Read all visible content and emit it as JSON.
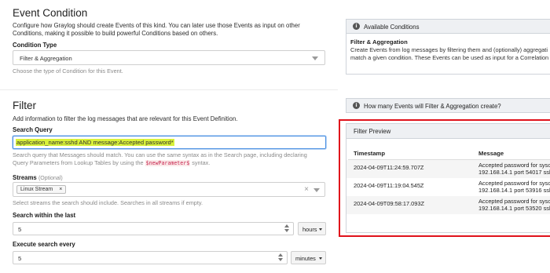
{
  "event_condition": {
    "title": "Event Condition",
    "description": "Configure how Graylog should create Events of this kind. You can later use those Events as input on other Conditions, making it possible to build powerful Conditions based on others.",
    "condition_type_label": "Condition Type",
    "condition_type_value": "Filter & Aggregation",
    "condition_type_help": "Choose the type of Condition for this Event."
  },
  "available_conditions": {
    "title": "Available Conditions",
    "body_title": "Filter & Aggregation",
    "body_text": "Create Events from log messages by filtering them and (optionally) aggregati match a given condition. These Events can be used as input for a Correlation"
  },
  "filter": {
    "title": "Filter",
    "description": "Add information to filter the log messages that are relevant for this Event Definition.",
    "search_query_label": "Search Query",
    "search_query_value": "application_name:sshd AND message:Accepted password*",
    "search_query_help_1": "Search query that Messages should match. You can use the same syntax as in the Search page, including declaring",
    "search_query_help_2": "Query Parameters from Lookup Tables by using the",
    "search_query_help_code": "$newParameter$",
    "search_query_help_3": "syntax.",
    "streams_label": "Streams",
    "streams_optional": "(Optional)",
    "stream_tag": "Linux Stream",
    "stream_tag_remove": "×",
    "streams_clear": "×",
    "streams_help": "Select streams the search should include. Searches in all streams if empty.",
    "search_within_label": "Search within the last",
    "search_within_value": "5",
    "search_within_unit": "hours",
    "execute_every_label": "Execute search every",
    "execute_every_value": "5",
    "execute_every_unit": "minutes"
  },
  "events_info": {
    "title": "How many Events will Filter & Aggregation create?"
  },
  "preview": {
    "title": "Filter Preview",
    "col_timestamp": "Timestamp",
    "col_message": "Message",
    "rows": [
      {
        "timestamp": "2024-04-09T11:24:59.707Z",
        "message_1": "Accepted password for syso",
        "message_2": "192.168.14.1 port 54017 ssh"
      },
      {
        "timestamp": "2024-04-09T11:19:04.545Z",
        "message_1": "Accepted password for syso",
        "message_2": "192.168.14.1 port 53916 ssh"
      },
      {
        "timestamp": "2024-04-09T09:58:17.093Z",
        "message_1": "Accepted password for syso",
        "message_2": "192.168.14.1 port 53520 ssh"
      }
    ]
  },
  "icons": {
    "info": "info-circle-icon",
    "caret": "caret-down-icon",
    "spinner": "number-spinner-icon"
  },
  "colors": {
    "highlight": "#d9f23a",
    "annotation_red": "#e0121b",
    "panel_header": "#eef0f3"
  }
}
